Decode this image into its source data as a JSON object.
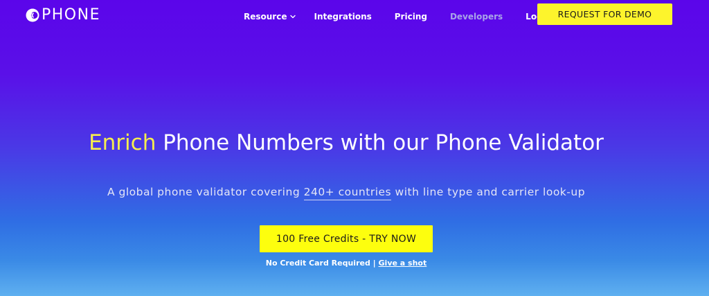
{
  "brand": {
    "name": "PHONE",
    "logo_icon": "phone-c-logo-icon"
  },
  "nav": {
    "items": [
      {
        "label": "Resource",
        "has_dropdown": true
      },
      {
        "label": "Integrations"
      },
      {
        "label": "Pricing"
      },
      {
        "label": "Developers",
        "muted": true
      },
      {
        "label": "Login"
      }
    ],
    "demo_button": "REQUEST FOR DEMO"
  },
  "hero": {
    "title_accent": "Enrich",
    "title_rest": " Phone Numbers with our Phone Validator",
    "subtitle_before": "A global phone validator covering ",
    "subtitle_link": "240+ countries",
    "subtitle_after": " with line type and carrier look-up",
    "cta_button": "100 Free Credits - TRY NOW",
    "note_text": "No Credit Card Required | ",
    "note_link": "Give a shot"
  },
  "colors": {
    "gradient_top": "#5b05ea",
    "gradient_bottom": "#5fb0f0",
    "accent_yellow": "#f6ee4d",
    "button_yellow": "#fdfe0e",
    "nav_muted": "#a9a4e8"
  }
}
